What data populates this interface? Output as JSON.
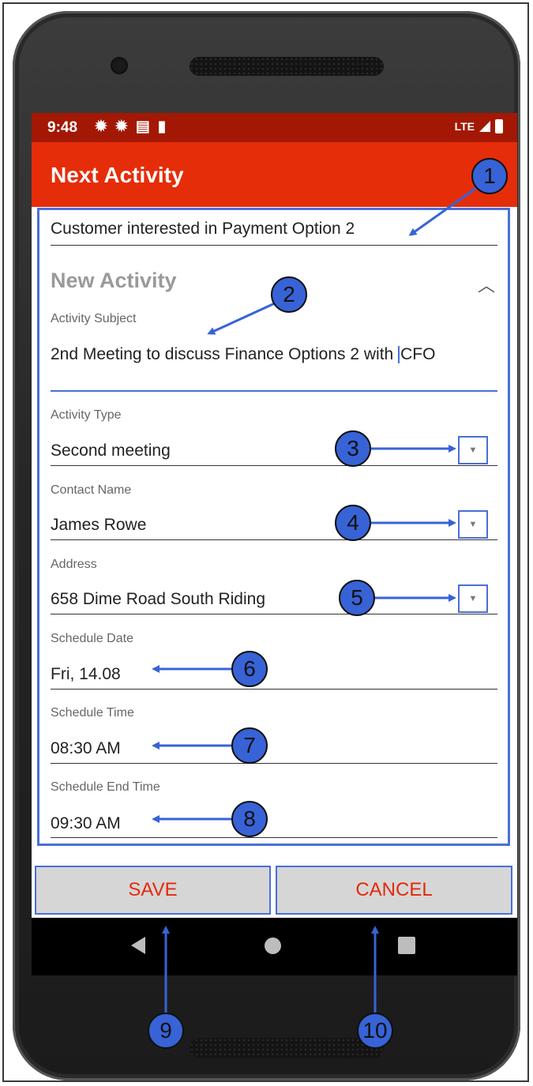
{
  "status_bar": {
    "time": "9:48",
    "icons": [
      "gear-icon",
      "gear-icon",
      "card-icon",
      "sd-card-icon"
    ],
    "network": "LTE"
  },
  "app_bar": {
    "title": "Next Activity"
  },
  "form": {
    "top_value": "Customer interested in Payment Option 2",
    "section_title": "New Activity",
    "subject": {
      "label": "Activity Subject",
      "value_before_cursor": "2nd Meeting to discuss Finance Options 2 with ",
      "value_after_cursor": "CFO"
    },
    "activity_type": {
      "label": "Activity Type",
      "value": "Second meeting"
    },
    "contact_name": {
      "label": "Contact Name",
      "value": "James Rowe"
    },
    "address": {
      "label": "Address",
      "value": "658 Dime Road South Riding"
    },
    "schedule_date": {
      "label": "Schedule Date",
      "value": "Fri, 14.08"
    },
    "schedule_time": {
      "label": "Schedule Time",
      "value": "08:30 AM"
    },
    "schedule_end_time": {
      "label": "Schedule End Time",
      "value": "09:30 AM"
    }
  },
  "buttons": {
    "save": "SAVE",
    "cancel": "CANCEL"
  },
  "callouts": [
    "1",
    "2",
    "3",
    "4",
    "5",
    "6",
    "7",
    "8",
    "9",
    "10"
  ],
  "colors": {
    "status_bar": "#a31805",
    "app_bar": "#e52d09",
    "annotation": "#3763d6",
    "button_text": "#e22a0a"
  }
}
